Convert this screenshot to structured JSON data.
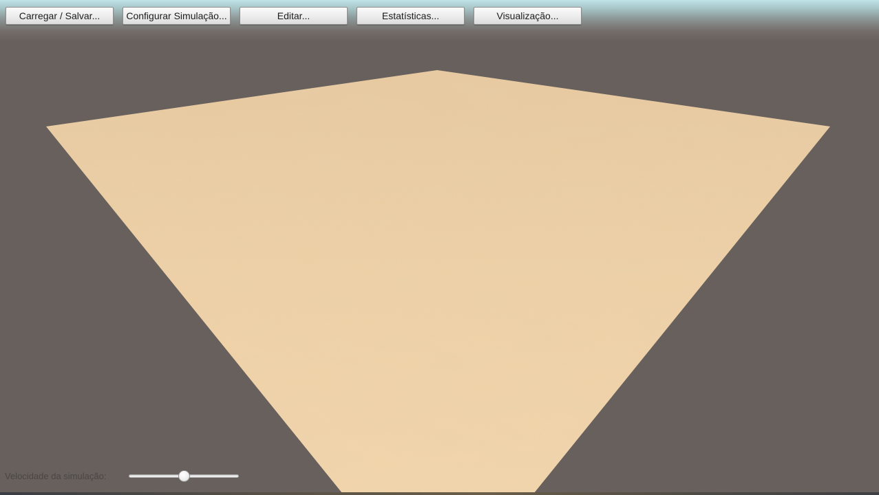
{
  "toolbar": {
    "buttons": [
      {
        "label": "Carregar / Salvar..."
      },
      {
        "label": "Configurar Simulação..."
      },
      {
        "label": "Editar..."
      },
      {
        "label": "Estatísticas..."
      },
      {
        "label": "Visualização..."
      }
    ]
  },
  "scene": {
    "sky_color": "#bfe3e6",
    "background_color": "#67605d",
    "ground_color": "#ecc99a",
    "ground_texture": "sand"
  },
  "speed_control": {
    "label": "Velocidade da simulação:",
    "value_fraction": 0.5
  }
}
